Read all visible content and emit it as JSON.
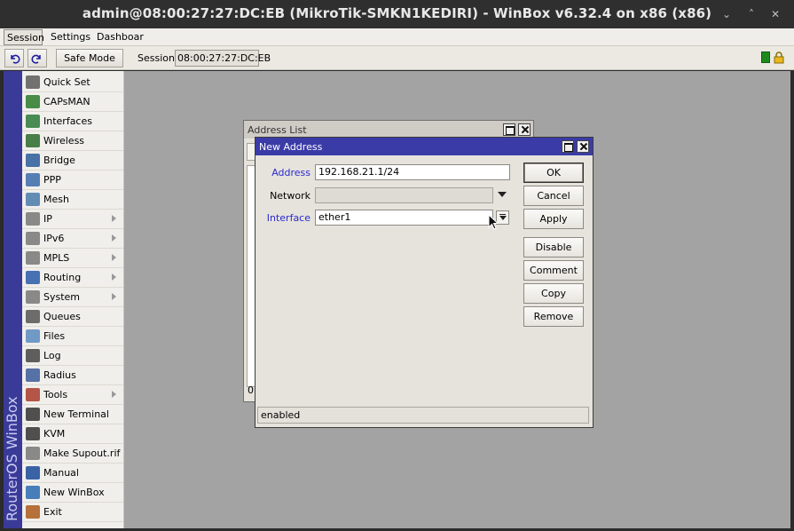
{
  "window": {
    "title": "admin@08:00:27:27:DC:EB (MikroTik-SMKN1KEDIRI) - WinBox v6.32.4 on x86 (x86)",
    "minimize_glyph": "⌄",
    "maximize_glyph": "˄",
    "close_glyph": "✕"
  },
  "menu": {
    "items": [
      "Session",
      "Settings",
      "Dashboard"
    ]
  },
  "toolbar": {
    "undo_icon": "undo-icon",
    "redo_icon": "redo-icon",
    "safe_mode_label": "Safe Mode",
    "session_label": "Session",
    "session_value": "08:00:27:27:DC:EB"
  },
  "sidebar": {
    "brand": "RouterOS WinBox",
    "items": [
      {
        "label": "Quick Set",
        "icon": "quick-set-icon",
        "submenu": false
      },
      {
        "label": "CAPsMAN",
        "icon": "capsman-icon",
        "submenu": false
      },
      {
        "label": "Interfaces",
        "icon": "interfaces-icon",
        "submenu": false
      },
      {
        "label": "Wireless",
        "icon": "wireless-icon",
        "submenu": false
      },
      {
        "label": "Bridge",
        "icon": "bridge-icon",
        "submenu": false
      },
      {
        "label": "PPP",
        "icon": "ppp-icon",
        "submenu": false
      },
      {
        "label": "Mesh",
        "icon": "mesh-icon",
        "submenu": false
      },
      {
        "label": "IP",
        "icon": "ip-icon",
        "submenu": true
      },
      {
        "label": "IPv6",
        "icon": "ipv6-icon",
        "submenu": true
      },
      {
        "label": "MPLS",
        "icon": "mpls-icon",
        "submenu": true
      },
      {
        "label": "Routing",
        "icon": "routing-icon",
        "submenu": true
      },
      {
        "label": "System",
        "icon": "system-icon",
        "submenu": true
      },
      {
        "label": "Queues",
        "icon": "queues-icon",
        "submenu": false
      },
      {
        "label": "Files",
        "icon": "files-icon",
        "submenu": false
      },
      {
        "label": "Log",
        "icon": "log-icon",
        "submenu": false
      },
      {
        "label": "Radius",
        "icon": "radius-icon",
        "submenu": false
      },
      {
        "label": "Tools",
        "icon": "tools-icon",
        "submenu": true
      },
      {
        "label": "New Terminal",
        "icon": "terminal-icon",
        "submenu": false
      },
      {
        "label": "KVM",
        "icon": "kvm-icon",
        "submenu": false
      },
      {
        "label": "Make Supout.rif",
        "icon": "supout-icon",
        "submenu": false
      },
      {
        "label": "Manual",
        "icon": "manual-icon",
        "submenu": false
      },
      {
        "label": "New WinBox",
        "icon": "new-winbox-icon",
        "submenu": false
      },
      {
        "label": "Exit",
        "icon": "exit-icon",
        "submenu": false
      }
    ]
  },
  "address_list": {
    "title": "Address List",
    "count_fragment": "0"
  },
  "new_address": {
    "title": "New Address",
    "fields": {
      "address_label": "Address",
      "address_value": "192.168.21.1/24",
      "network_label": "Network",
      "network_value": "",
      "interface_label": "Interface",
      "interface_value": "ether1"
    },
    "buttons": {
      "ok": "OK",
      "cancel": "Cancel",
      "apply": "Apply",
      "disable": "Disable",
      "comment": "Comment",
      "copy": "Copy",
      "remove": "Remove"
    },
    "status": "enabled"
  },
  "colors": {
    "accent_blue": "#3b3ba8",
    "label_blue": "#2a2ad0",
    "workspace_gray": "#a3a3a3"
  }
}
